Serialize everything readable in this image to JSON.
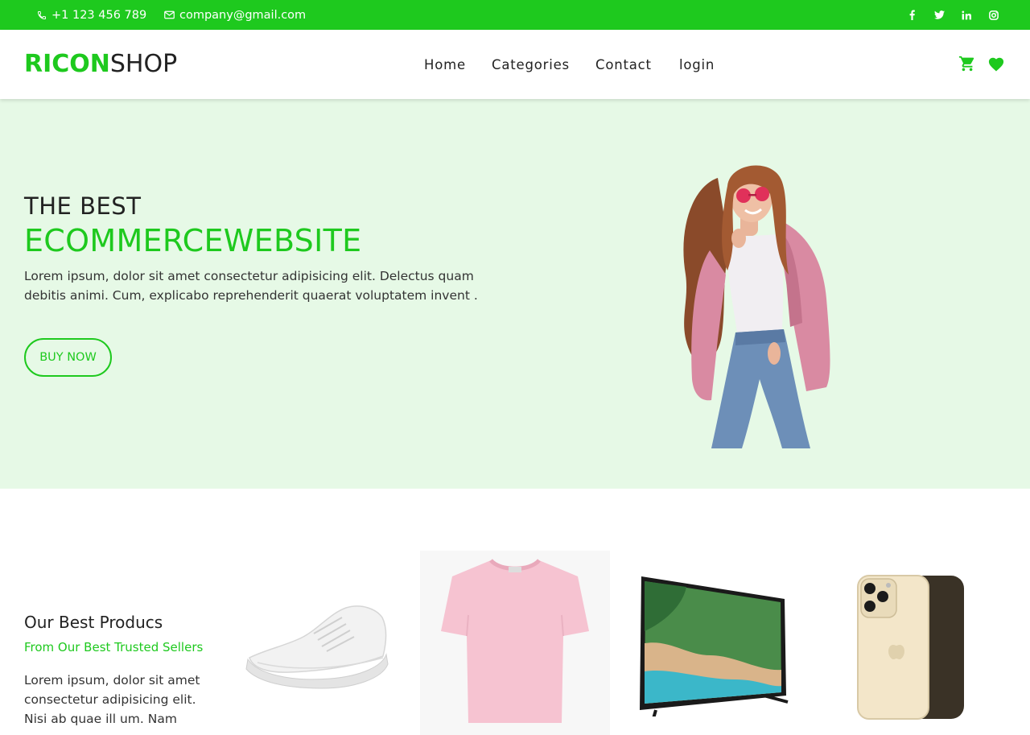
{
  "topbar": {
    "phone": "+1 123 456 789",
    "email": "company@gmail.com",
    "social": [
      "facebook-icon",
      "twitter-icon",
      "linkedin-icon",
      "instagram-icon"
    ]
  },
  "header": {
    "logo_bold": "RICON",
    "logo_light": "SHOP",
    "nav": [
      "Home",
      "Categories",
      "Contact",
      "login"
    ],
    "icons": [
      "cart-icon",
      "heart-icon"
    ]
  },
  "hero": {
    "kicker": "THE BEST",
    "headline": "ECOMMERCEWEBSITE",
    "description": "Lorem ipsum, dolor sit amet consectetur adipisicing elit. Delectus quam debitis animi. Cum, explicabo reprehenderit quaerat voluptatem invent .",
    "button": "BUY NOW"
  },
  "products": {
    "title": "Our Best Producs",
    "subtitle": "From Our Best Trusted Sellers",
    "text": "Lorem ipsum, dolor sit amet consectetur adipisicing elit. Nisi ab quae ill um. Nam",
    "items": [
      "shoe-image",
      "tshirt-image",
      "tv-image",
      "phone-image"
    ]
  },
  "colors": {
    "accent": "#1ec91e",
    "hero_bg": "#e6f9e6",
    "text": "#222222"
  }
}
